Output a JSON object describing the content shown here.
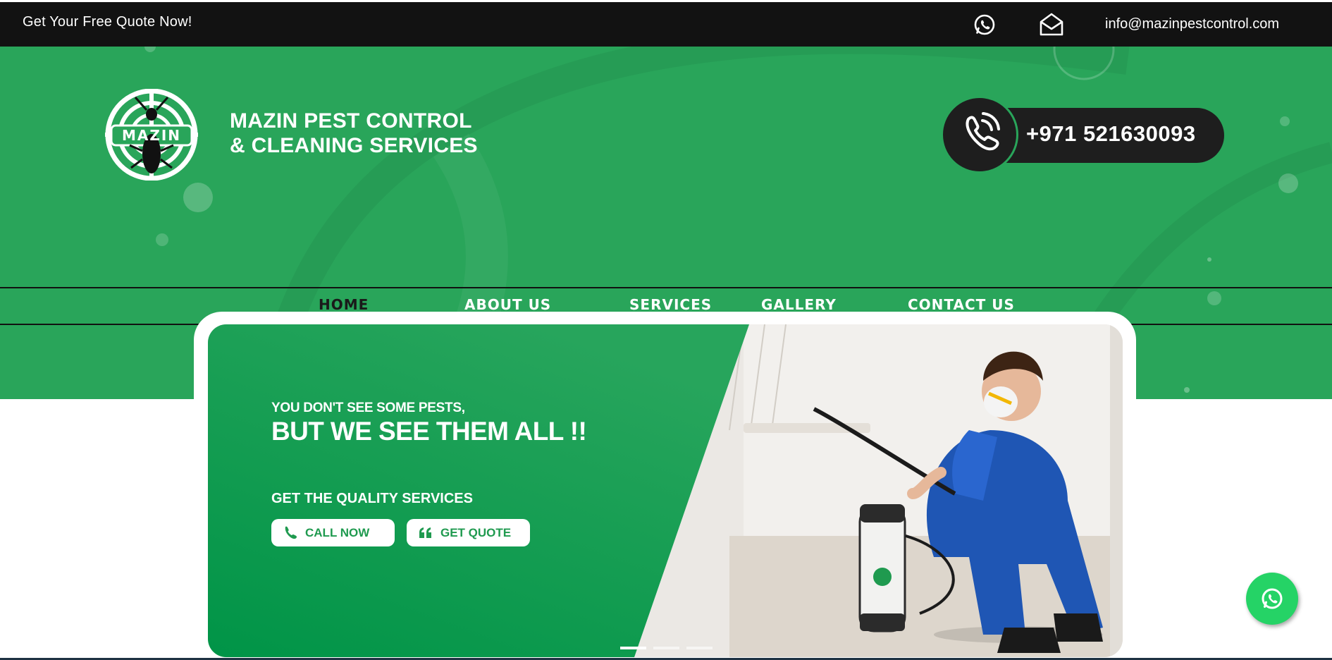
{
  "topbar": {
    "quote_text": "Get Your Free Quote Now!",
    "email": "info@mazinpestcontrol.com",
    "icons": [
      "whatsapp-icon",
      "mail-icon"
    ]
  },
  "header": {
    "logo_text": "MAZIN",
    "brand_line1": "MAZIN PEST CONTROL",
    "brand_line2": "& CLEANING SERVICES",
    "phone": "+971 521630093"
  },
  "nav": {
    "items": [
      {
        "label": "HOME",
        "active": true
      },
      {
        "label": "ABOUT US",
        "active": false
      },
      {
        "label": "SERVICES",
        "active": false
      },
      {
        "label": "GALLERY",
        "active": false
      },
      {
        "label": "CONTACT US",
        "active": false
      }
    ]
  },
  "hero": {
    "tagline_small": "YOU DON'T SEE SOME PESTS,",
    "tagline_big": "BUT WE SEE THEM ALL !!",
    "subtitle": "GET THE QUALITY SERVICES",
    "call_button": "CALL NOW",
    "quote_button": "GET QUOTE",
    "slide_count": 3,
    "active_slide": 1
  },
  "colors": {
    "brand_green": "#29a55a",
    "topbar_bg": "#121212",
    "whatsapp_green": "#25d366",
    "button_text": "#1f9a4f"
  }
}
